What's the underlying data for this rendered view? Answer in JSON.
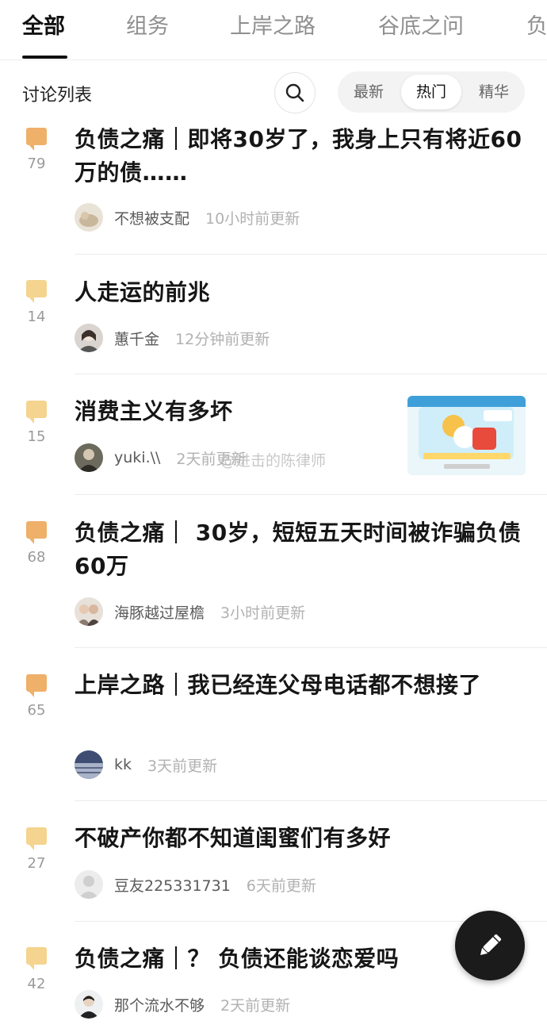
{
  "tabs": [
    {
      "label": "全部",
      "active": true
    },
    {
      "label": "组务",
      "active": false
    },
    {
      "label": "上岸之路",
      "active": false
    },
    {
      "label": "谷底之问",
      "active": false
    },
    {
      "label": "负",
      "active": false
    }
  ],
  "subheader": {
    "title": "讨论列表",
    "sort_options": [
      {
        "label": "最新",
        "active": false
      },
      {
        "label": "热门",
        "active": true
      },
      {
        "label": "精华",
        "active": false
      }
    ]
  },
  "colors": {
    "icon_hot": "#efb06a",
    "icon_normal": "#f4d48f",
    "fab": "#1b1b1b"
  },
  "posts": [
    {
      "title": "负债之痛｜即将30岁了，我身上只有将近60万的债……",
      "count": "79",
      "author": "不想被支配",
      "time": "10小时前更新",
      "icon": "hot"
    },
    {
      "title": "人走运的前兆",
      "count": "14",
      "author": "蕙千金",
      "time": "12分钟前更新",
      "icon": "normal"
    },
    {
      "title": "消费主义有多坏",
      "count": "15",
      "author": "yuki.\\\\",
      "time": "2天前更新",
      "icon": "normal",
      "has_thumbnail": true
    },
    {
      "title": "负债之痛｜ 30岁，短短五天时间被诈骗负债60万",
      "count": "68",
      "author": "海豚越过屋檐",
      "time": "3小时前更新",
      "icon": "hot"
    },
    {
      "title": "上岸之路｜我已经连父母电话都不想接了",
      "count": "65",
      "author": "kk",
      "time": "3天前更新",
      "icon": "hot"
    },
    {
      "title": "不破产你都不知道闺蜜们有多好",
      "count": "27",
      "author": "豆友225331731",
      "time": "6天前更新",
      "icon": "normal"
    },
    {
      "title": "负债之痛｜？ 负债还能谈恋爱吗",
      "count": "42",
      "author": "那个流水不够",
      "time": "2天前更新",
      "icon": "normal"
    }
  ],
  "watermark": "@进击的陈律师",
  "icons": {
    "search": "search-icon",
    "compose": "pencil-icon"
  }
}
